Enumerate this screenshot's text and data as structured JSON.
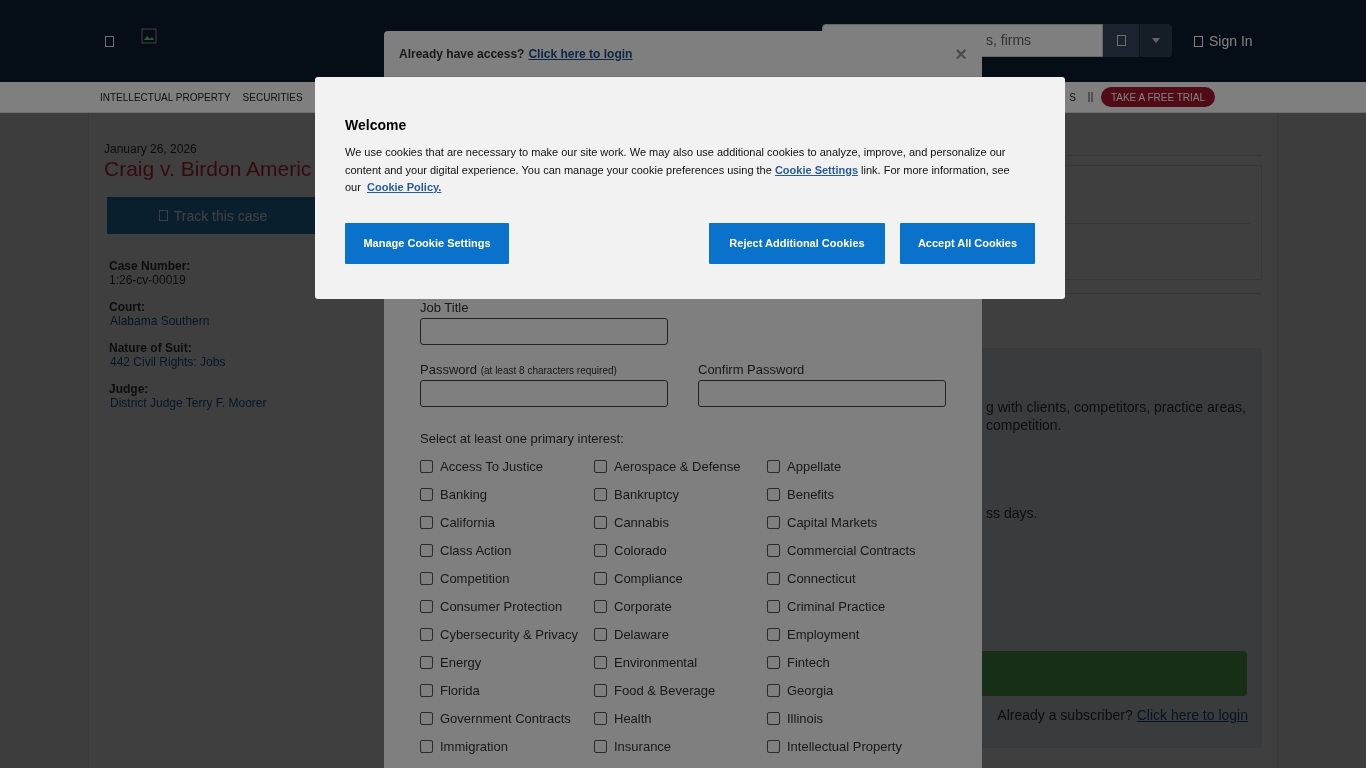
{
  "header": {
    "search": {
      "placeholder": "s, firms"
    },
    "sign_in": "Sign In"
  },
  "nav": {
    "items": [
      "INTELLECTUAL PROPERTY",
      "SECURITIES"
    ],
    "right_item": "S",
    "trial": "TAKE A FREE TRIAL"
  },
  "case": {
    "date": "January 26, 2026",
    "title": "Craig v. Birdon Americ",
    "track": "Track this case",
    "details": [
      {
        "label": "Case Number:",
        "value": "1:26-cv-00019",
        "kind": "text"
      },
      {
        "label": "Court:",
        "value": "Alabama Southern",
        "kind": "link"
      },
      {
        "label": "Nature of Suit:",
        "value": "442 Civil Rights: Jobs",
        "kind": "link"
      },
      {
        "label": "Judge:",
        "value": "District Judge Terry F. Moorer",
        "kind": "link"
      }
    ]
  },
  "promo": {
    "text_1": "g with clients, competitors, practice areas,",
    "text_2": "competition.",
    "text_3": "ss days.",
    "subscriber_text": "Already a subscriber?",
    "subscriber_link": "Click here to login"
  },
  "modal": {
    "access_text": "Already have access?",
    "login_link": "Click here to login",
    "close": "×",
    "job_title_label": "Job Title",
    "password_label": "Password",
    "password_hint": "(at least 8 characters required)",
    "confirm_label": "Confirm Password",
    "interests_label": "Select at least one primary interest:",
    "interests": [
      {
        "label": "Access To Justice",
        "checked": false
      },
      {
        "label": "Aerospace & Defense",
        "checked": false
      },
      {
        "label": "Appellate",
        "checked": false
      },
      {
        "label": "Banking",
        "checked": false
      },
      {
        "label": "Bankruptcy",
        "checked": false
      },
      {
        "label": "Benefits",
        "checked": false
      },
      {
        "label": "California",
        "checked": false
      },
      {
        "label": "Cannabis",
        "checked": false
      },
      {
        "label": "Capital Markets",
        "checked": false
      },
      {
        "label": "Class Action",
        "checked": false
      },
      {
        "label": "Colorado",
        "checked": false
      },
      {
        "label": "Commercial Contracts",
        "checked": false
      },
      {
        "label": "Competition",
        "checked": false
      },
      {
        "label": "Compliance",
        "checked": false
      },
      {
        "label": "Connecticut",
        "checked": false
      },
      {
        "label": "Consumer Protection",
        "checked": false
      },
      {
        "label": "Corporate",
        "checked": false
      },
      {
        "label": "Criminal Practice",
        "checked": false
      },
      {
        "label": "Cybersecurity & Privacy",
        "checked": false
      },
      {
        "label": "Delaware",
        "checked": false
      },
      {
        "label": "Employment",
        "checked": false
      },
      {
        "label": "Energy",
        "checked": false
      },
      {
        "label": "Environmental",
        "checked": false
      },
      {
        "label": "Fintech",
        "checked": false
      },
      {
        "label": "Florida",
        "checked": false
      },
      {
        "label": "Food & Beverage",
        "checked": false
      },
      {
        "label": "Georgia",
        "checked": false
      },
      {
        "label": "Government Contracts",
        "checked": false
      },
      {
        "label": "Health",
        "checked": false
      },
      {
        "label": "Illinois",
        "checked": false
      },
      {
        "label": "Immigration",
        "checked": false
      },
      {
        "label": "Insurance",
        "checked": false
      },
      {
        "label": "Intellectual Property",
        "checked": false
      }
    ]
  },
  "cookie_banner": {
    "title": "Welcome",
    "text_1": "We use cookies that are necessary to make our site work. We may also use additional cookies to analyze, improve, and personalize our content and your digital experience. You can manage your cookie preferences using the",
    "settings_link": "Cookie Settings",
    "text_2": "link. For more information, see our",
    "policy_link": "Cookie Policy.",
    "buttons": [
      "Manage Cookie Settings",
      "Reject Additional Cookies",
      "Accept All Cookies"
    ]
  }
}
